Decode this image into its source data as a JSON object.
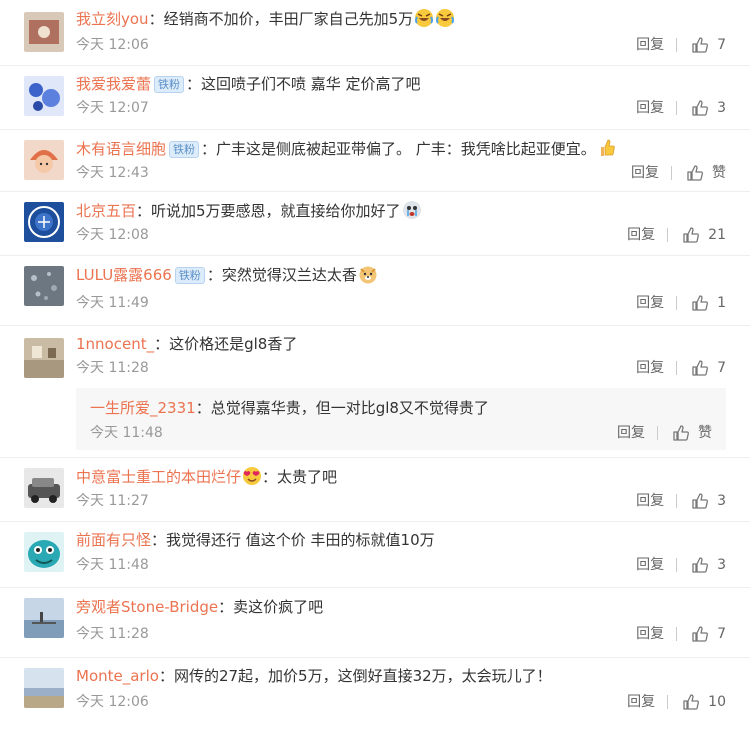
{
  "comments": [
    {
      "name": "我立刻you",
      "text": "：经销商不加价，丰田厂家自己先加5万",
      "time": "今天 12:06",
      "reply": "回复",
      "likes": "7",
      "avatar": "#b07060",
      "emoji": [
        "laugh-cry-icon",
        "laugh-cry-icon"
      ]
    },
    {
      "name": "我爱我爱蕾",
      "badge": "铁粉",
      "text": "：这回喷子们不喷 嘉华 定价高了吧",
      "time": "今天 12:07",
      "reply": "回复",
      "likes": "3",
      "avatar": "#3b63c9"
    },
    {
      "name": "木有语言细胞",
      "badge": "铁粉",
      "text": "：广丰这是侧底被起亚带偏了。 广丰：我凭啥比起亚便宜。",
      "time": "今天 12:43",
      "reply": "回复",
      "likes": "赞",
      "avatar": "#e07048",
      "emoji": [
        "thumbs-up-emoji-icon"
      ]
    },
    {
      "name": "北京五百",
      "text": "：听说加5万要感恩，就直接给你加好了",
      "time": "今天 12:08",
      "reply": "回复",
      "likes": "21",
      "avatar": "#1d4f9c",
      "emoji": [
        "crying-face-icon"
      ]
    },
    {
      "name": "LULU露露666",
      "badge": "铁粉",
      "text": "：突然觉得汉兰达太香",
      "time": "今天 11:49",
      "reply": "回复",
      "likes": "1",
      "avatar": "#6d7782",
      "emoji": [
        "doge-icon"
      ]
    },
    {
      "name": "1nnocent_",
      "text": "：这价格还是gl8香了",
      "time": "今天 11:28",
      "reply": "回复",
      "likes": "7",
      "avatar": "#a89880",
      "sub": {
        "name": "一生所爱_2331",
        "text": "：总觉得嘉华贵，但一对比gl8又不觉得贵了",
        "time": "今天 11:48",
        "reply": "回复",
        "likes": "赞"
      }
    },
    {
      "name": "中意富士重工的本田烂仔",
      "text": "：太贵了吧",
      "time": "今天 11:27",
      "reply": "回复",
      "likes": "3",
      "avatar": "#888888",
      "emoji": [
        "heart-eyes-icon"
      ]
    },
    {
      "name": "前面有只怪",
      "text": "：我觉得还行  值这个价  丰田的标就值10万",
      "time": "今天 11:48",
      "reply": "回复",
      "likes": "3",
      "avatar": "#2aa9b5"
    },
    {
      "name": "旁观者Stone-Bridge",
      "text": "：卖这价疯了吧",
      "time": "今天 11:28",
      "reply": "回复",
      "likes": "7",
      "avatar": "#7f9db8"
    },
    {
      "name": "Monte_arlo",
      "text": "：网传的27起，加价5万，这倒好直接32万，太会玩儿了！",
      "time": "今天 12:06",
      "reply": "回复",
      "likes": "10",
      "avatar": "#9bb0c8"
    }
  ]
}
